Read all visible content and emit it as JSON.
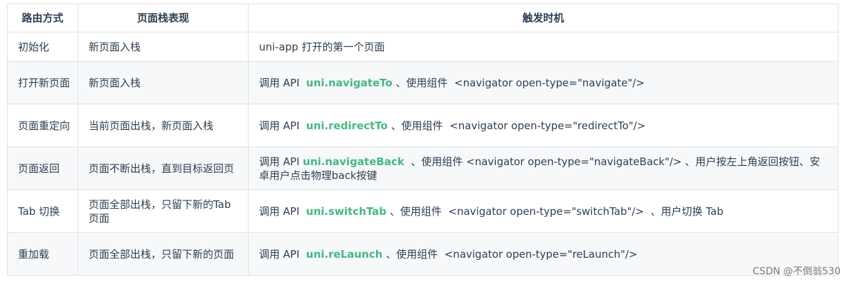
{
  "table": {
    "headers": [
      "路由方式",
      "页面栈表现",
      "触发时机"
    ],
    "rows": [
      {
        "route": "初始化",
        "stack": "新页面入栈",
        "trigger_pre": "uni-app 打开的第一个页面",
        "api": "",
        "trigger_post": ""
      },
      {
        "route": "打开新页面",
        "stack": "新页面入栈",
        "trigger_pre": "调用 API  ",
        "api": "uni.navigateTo",
        "trigger_post": " 、使用组件  <navigator open-type=\"navigate\"/>"
      },
      {
        "route": "页面重定向",
        "stack": "当前页面出栈，新页面入栈",
        "trigger_pre": "调用 API  ",
        "api": "uni.redirectTo",
        "trigger_post": " 、使用组件  <navigator open-type=\"redirectTo\"/>"
      },
      {
        "route": "页面返回",
        "stack": "页面不断出栈，直到目标返回页",
        "trigger_pre": "调用 API ",
        "api": "uni.navigateBack",
        "trigger_post": "  、使用组件 <navigator open-type=\"navigateBack\"/> 、用户按左上角返回按钮、安卓用户点击物理back按键"
      },
      {
        "route": "Tab 切换",
        "stack": "页面全部出栈，只留下新的Tab 页面",
        "trigger_pre": "调用 API  ",
        "api": "uni.switchTab",
        "trigger_post": " 、使用组件  <navigator open-type=\"switchTab\"/>  、用户切换 Tab"
      },
      {
        "route": "重加载",
        "stack": "页面全部出栈，只留下新的页面",
        "trigger_pre": "调用 API  ",
        "api": "uni.reLaunch",
        "trigger_post": " 、使用组件  <navigator open-type=\"reLaunch\"/>"
      }
    ]
  },
  "watermark": "CSDN @不倒翁530",
  "colors": {
    "api_link": "#42b983",
    "stripe": "#f6f8fa",
    "border": "#dfe2e5"
  }
}
